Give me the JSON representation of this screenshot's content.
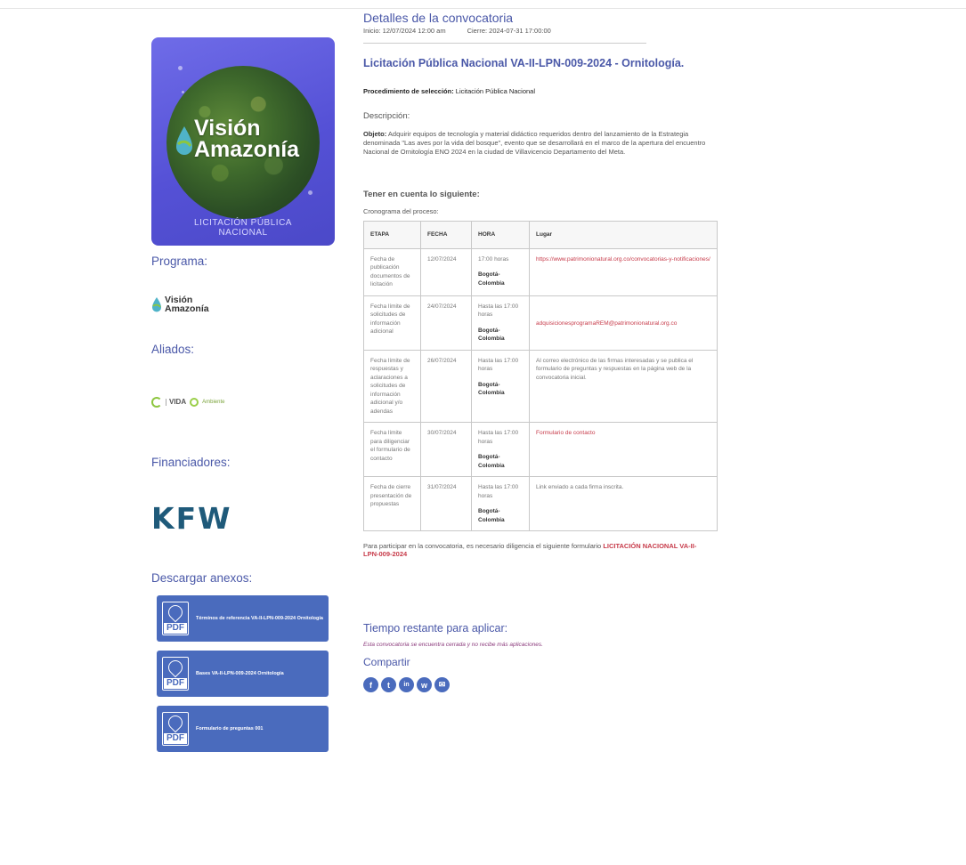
{
  "left": {
    "cover": {
      "brand_line1": "Visión",
      "brand_line2": "Amazonía",
      "subtitle_line1": "LICITACIÓN PÚBLICA",
      "subtitle_line2": "NACIONAL"
    },
    "programa_title": "Programa:",
    "programa_logo_line1": "Visión",
    "programa_logo_line2": "Amazonía",
    "aliados_title": "Aliados:",
    "aliados_logo_text1": "VIDA",
    "aliados_logo_text2": "Ambiente",
    "financiadores_title": "Financiadores:",
    "kfw_logo": "KFW",
    "anexos_title": "Descargar anexos:",
    "anexos": [
      {
        "label": "Términos de referencia VA-II-LPN-009-2024 Ornitología",
        "icon_label": "PDF"
      },
      {
        "label": "Bases VA-II-LPN-009-2024 Ornitología",
        "icon_label": "PDF"
      },
      {
        "label": "Formulario de preguntas 001",
        "icon_label": "PDF"
      }
    ]
  },
  "main": {
    "title": "Detalles de la convocatoria",
    "inicio": "Inicio: 12/07/2024 12:00 am",
    "cierre": "Cierre: 2024-07-31 17:00:00",
    "licitacion_title": "Licitación Pública Nacional VA-II-LPN-009-2024 - Ornitología.",
    "procedimiento_label": "Procedimiento de selección:",
    "procedimiento_value": "Licitación Pública Nacional",
    "descripcion_title": "Descripción:",
    "objeto_label": "Objeto:",
    "objeto_text": "Adquirir equipos de tecnología y material didáctico requeridos dentro del lanzamiento de la Estrategia denominada \"Las aves por la vida del bosque\", evento que se desarrollará en el marco de la apertura del encuentro Nacional de Ornitología ENO 2024 en la ciudad de Villavicencio Departamento del Meta.",
    "tener_title": "Tener en cuenta lo siguiente:",
    "cronograma_title": "Cronograma del proceso:",
    "table": {
      "headers": [
        "ETAPA",
        "FECHA",
        "HORA",
        "Lugar"
      ],
      "rows": [
        {
          "etapa": "Fecha de publicación documentos de licitación",
          "fecha": "12/07/2024",
          "hora": "17:00 horas",
          "zona": "Bogotá-Colombia",
          "lugar": "https://www.patrimonionatural.org.co/convocatorias-y-notificaciones/",
          "lugar_is_link": true
        },
        {
          "etapa": "Fecha límite de solicitudes de información adicional",
          "fecha": "24/07/2024",
          "hora": "Hasta las 17:00 horas",
          "zona": "Bogotá-Colombia",
          "lugar": "adquisicionesprogramaREM@patrimonionatural.org.co",
          "lugar_is_link": true
        },
        {
          "etapa": "Fecha límite de respuestas y aclaraciones a solicitudes de información adicional y/o adendas",
          "fecha": "26/07/2024",
          "hora": "Hasta las 17:00 horas",
          "zona": "Bogotá-Colombia",
          "lugar": "Al correo electrónico de las firmas interesadas y se publica el formulario de preguntas y respuestas en la página web de la convocatoria inicial.",
          "lugar_is_link": false
        },
        {
          "etapa": "Fecha límite para diligenciar el formulario de contacto",
          "fecha": "30/07/2024",
          "hora": "Hasta las 17:00 horas",
          "zona": "Bogotá-Colombia",
          "lugar": "Formulario de contacto",
          "lugar_is_link": true
        },
        {
          "etapa": "Fecha de cierre presentación de propuestas",
          "fecha": "31/07/2024",
          "hora": "Hasta las 17:00 horas",
          "zona": "Bogotá-Colombia",
          "lugar": "Link enviado a cada firma inscrita.",
          "lugar_is_link": false
        }
      ]
    },
    "participar_text": "Para participar en la convocatoria, es necesario diligencia el siguiente formulario",
    "participar_link": "LICITACIÓN NACIONAL VA-II-LPN-009-2024",
    "tiempo_title": "Tiempo restante para aplicar:",
    "cerrada_text": "Esta convocatoria se encuentra cerrada y no recibe más aplicaciones.",
    "compartir_title": "Compartir",
    "social": [
      {
        "name": "facebook",
        "glyph": "f"
      },
      {
        "name": "twitter",
        "glyph": "t"
      },
      {
        "name": "linkedin",
        "glyph": "in"
      },
      {
        "name": "whatsapp",
        "glyph": "w"
      },
      {
        "name": "email",
        "glyph": "✉"
      }
    ]
  }
}
